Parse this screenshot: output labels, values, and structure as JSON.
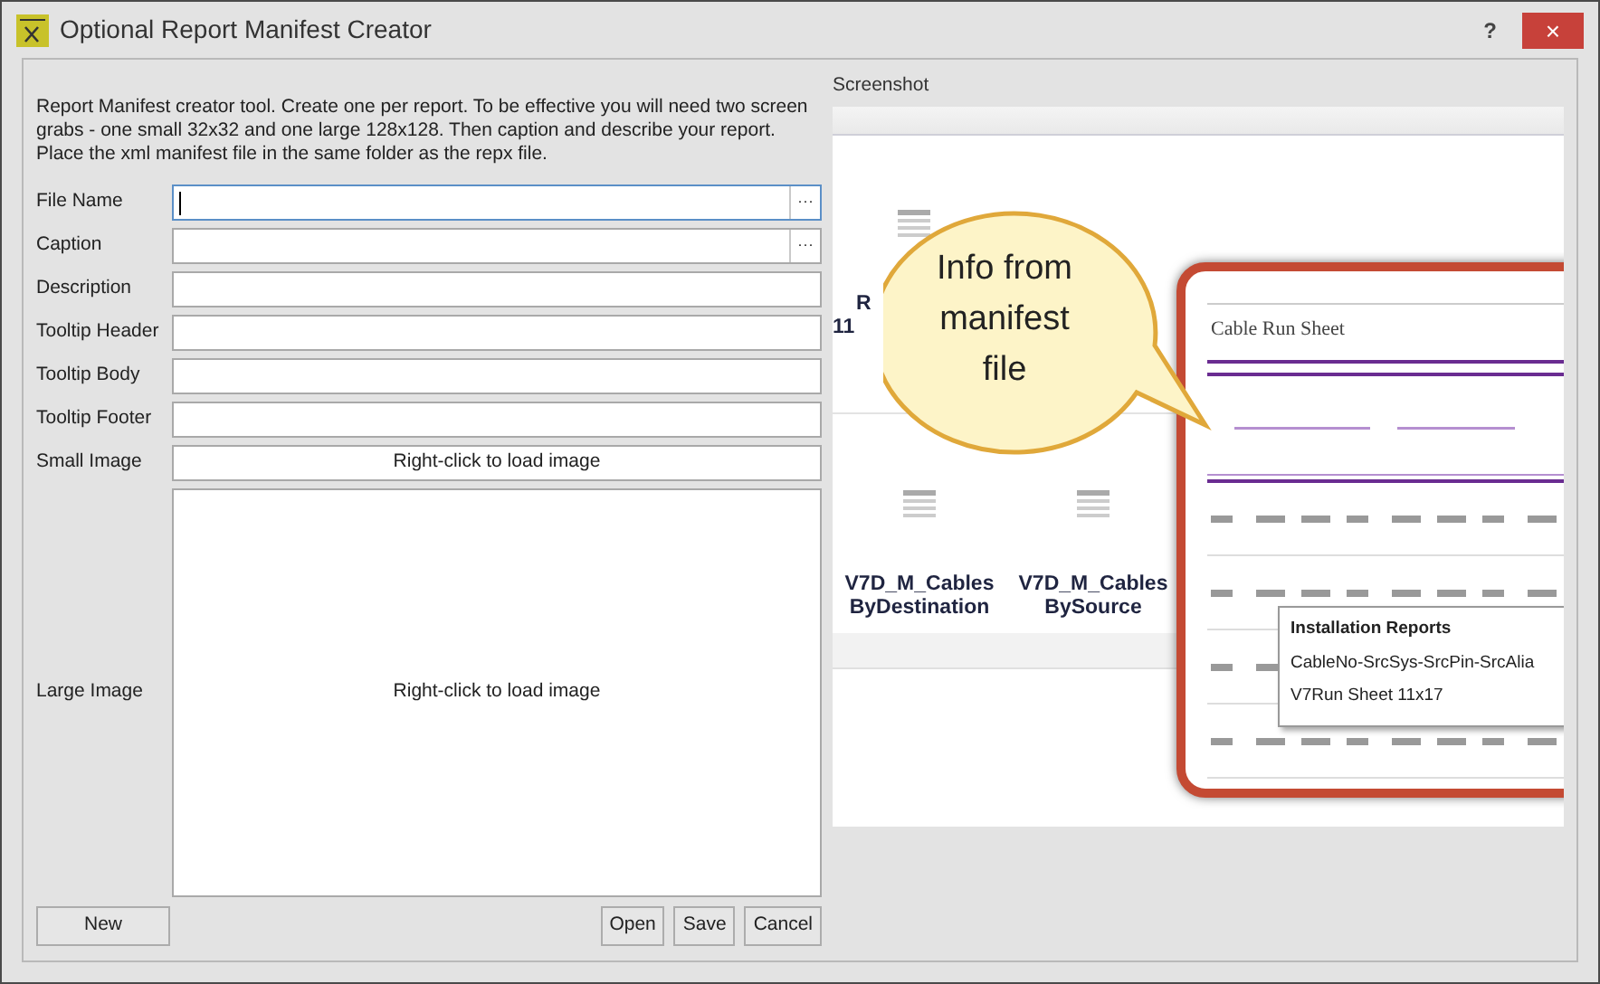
{
  "window": {
    "title": "Optional Report Manifest Creator",
    "help": "?",
    "close": "×"
  },
  "intro": "Report Manifest creator tool. Create one per report. To be effective you will need two screen grabs - one small 32x32 and one large 128x128. Then caption and describe your report. Place the xml manifest file in the same folder as the repx file.",
  "fields": [
    {
      "label": "File Name",
      "kind": "text",
      "focused": true,
      "browse": "···"
    },
    {
      "label": "Caption",
      "kind": "text",
      "focused": false,
      "browse": "···"
    },
    {
      "label": "Description",
      "kind": "text",
      "focused": false
    },
    {
      "label": "Tooltip Header",
      "kind": "text",
      "focused": false
    },
    {
      "label": "Tooltip Body",
      "kind": "text",
      "focused": false
    },
    {
      "label": "Tooltip Footer",
      "kind": "text",
      "focused": false
    },
    {
      "label": "Small Image",
      "kind": "image",
      "hint": "Right-click to load image"
    },
    {
      "label": "Large Image",
      "kind": "large-image",
      "hint": "Right-click to load image"
    }
  ],
  "buttons_left": [
    "New"
  ],
  "buttons_right": [
    "Open",
    "Save",
    "Cancel"
  ],
  "screenshot": {
    "label": "Screenshot",
    "tiles": [
      {
        "lines": [
          "R",
          "11"
        ]
      },
      {
        "lines": [
          "V7D_M_Cables",
          "ByDestination"
        ]
      },
      {
        "lines": [
          "V7D_M_Cables",
          "BySource"
        ]
      }
    ],
    "callout": "Info from manifest file",
    "sheet_title": "Cable Run Sheet",
    "tooltip": {
      "title": "Installation Reports",
      "items": [
        "CableNo-SrcSys-SrcPin-SrcAlia",
        "V7Run Sheet 11x17"
      ]
    }
  }
}
